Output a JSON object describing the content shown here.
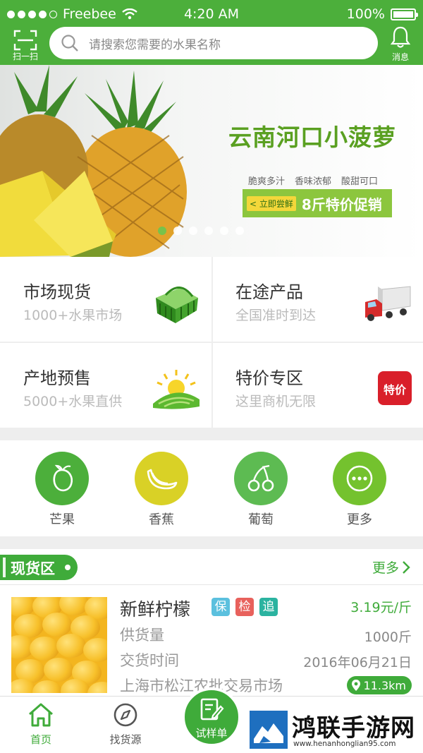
{
  "status": {
    "carrier": "Freebee",
    "time": "4:20 AM",
    "battery": "100%"
  },
  "header": {
    "scan_label": "扫一扫",
    "search_placeholder": "请搜索您需要的水果名称",
    "message_label": "消息"
  },
  "banner": {
    "title": "云南河口小菠萝",
    "tags": [
      "脆爽多汁",
      "香味浓郁",
      "酸甜可口"
    ],
    "chip": "< 立即尝鲜",
    "promo": "8斤特价促销",
    "slides": 6,
    "active_slide": 1
  },
  "categories": [
    {
      "title": "市场现货",
      "subtitle": "1000+水果市场",
      "icon": "basket-icon"
    },
    {
      "title": "在途产品",
      "subtitle": "全国准时到达",
      "icon": "truck-icon"
    },
    {
      "title": "产地预售",
      "subtitle": "5000+水果直供",
      "icon": "farm-sun-icon"
    },
    {
      "title": "特价专区",
      "subtitle": "这里商机无限",
      "icon": "sale-bag-icon",
      "badge": "特价"
    }
  ],
  "fruits": [
    {
      "label": "芒果",
      "icon": "mango-icon",
      "color": "#4caf3b"
    },
    {
      "label": "香蕉",
      "icon": "banana-icon",
      "color": "#d9d126"
    },
    {
      "label": "葡萄",
      "icon": "cherry-icon",
      "color": "#5dbb52"
    },
    {
      "label": "更多",
      "icon": "more-icon",
      "color": "#74c22e"
    }
  ],
  "spot": {
    "section_title": "现货区",
    "more": "更多",
    "product": {
      "name": "新鲜柠檬",
      "badges": [
        "保",
        "检",
        "追"
      ],
      "price": "3.19元/斤",
      "supply_label": "供货量",
      "supply_value": "1000斤",
      "date_label": "交货时间",
      "date_value": "2016年06月21日",
      "market": "上海市松江农批交易市场",
      "distance": "11.3km"
    }
  },
  "tabs": {
    "home": "首页",
    "find": "找货源",
    "center": "试样单"
  },
  "watermark": {
    "name": "鸿联手游网",
    "url": "www.henanhonglian95.com"
  },
  "colors": {
    "brand": "#4caf3b",
    "accent": "#3fab3a",
    "badge_blue": "#5bc0de",
    "badge_red": "#e8615c",
    "badge_teal": "#2bb3a0"
  }
}
